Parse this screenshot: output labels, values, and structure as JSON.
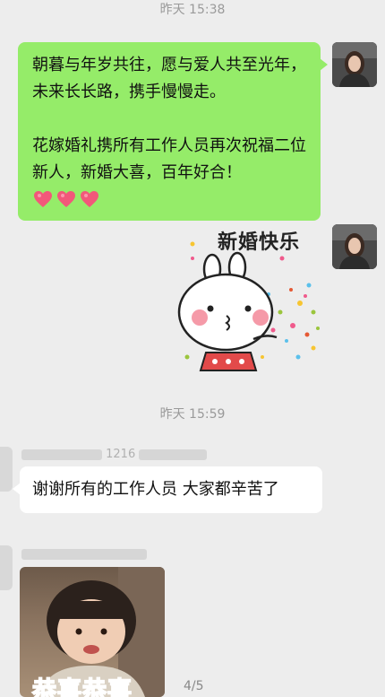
{
  "timestamps": {
    "first": "昨天 15:38",
    "second": "昨天 15:59"
  },
  "outgoing_message": {
    "paragraph1": "朝暮与年岁共往，愿与爱人共至光年，未来长长路，携手慢慢走。",
    "paragraph2": "花嫁婚礼携所有工作人员再次祝福二位新人，新婚大喜，百年好合！"
  },
  "sticker_outgoing": {
    "text": "新婚快乐"
  },
  "incoming_message_1": {
    "sender_partial": "1216",
    "text": "谢谢所有的工作人员 大家都辛苦了"
  },
  "incoming_image": {
    "caption": "恭喜恭喜"
  },
  "page_indicator": "4/5",
  "colors": {
    "outgoing_bubble": "#95ec69",
    "incoming_bubble": "#ffffff",
    "background": "#ededed"
  }
}
